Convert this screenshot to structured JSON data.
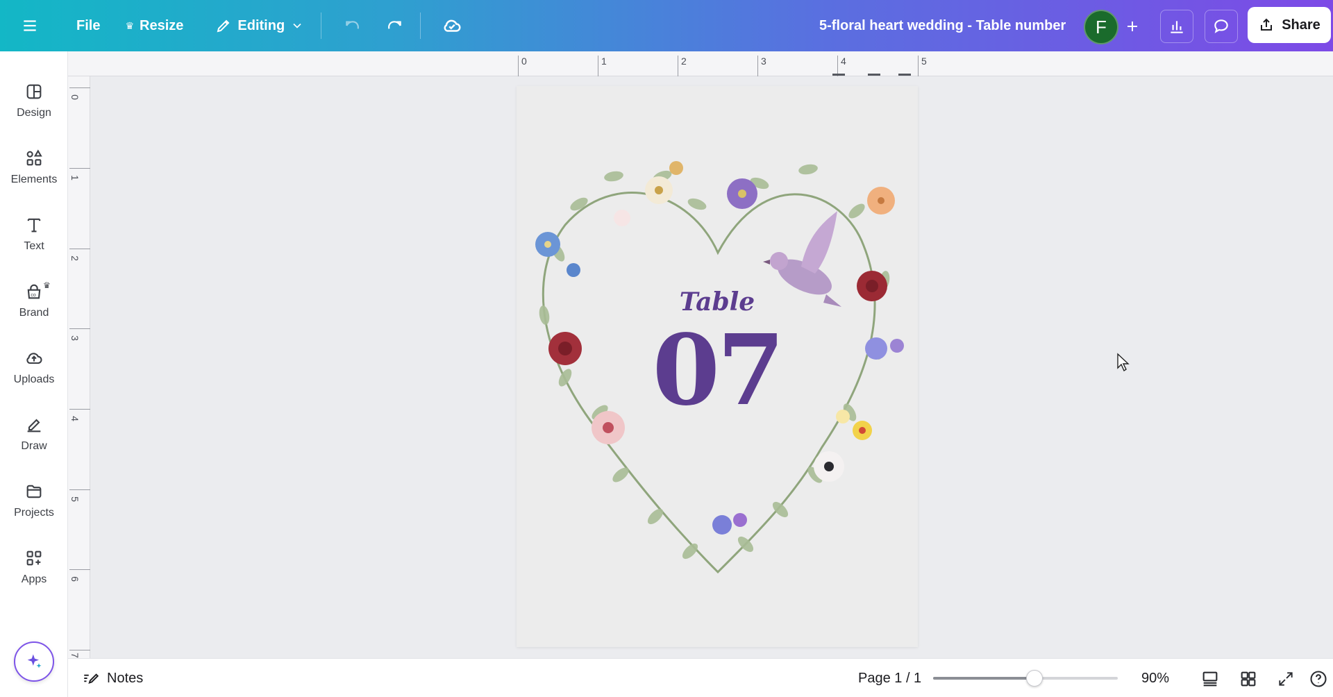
{
  "topbar": {
    "file_label": "File",
    "resize_label": "Resize",
    "mode_label": "Editing",
    "doc_title": "5-floral heart wedding - Table number",
    "avatar_initial": "F",
    "share_label": "Share"
  },
  "sidebar": {
    "items": [
      {
        "label": "Design",
        "icon": "design-icon"
      },
      {
        "label": "Elements",
        "icon": "elements-icon"
      },
      {
        "label": "Text",
        "icon": "text-icon"
      },
      {
        "label": "Brand",
        "icon": "brand-icon"
      },
      {
        "label": "Uploads",
        "icon": "uploads-icon"
      },
      {
        "label": "Draw",
        "icon": "draw-icon"
      },
      {
        "label": "Projects",
        "icon": "projects-icon"
      },
      {
        "label": "Apps",
        "icon": "apps-icon"
      }
    ]
  },
  "rulers": {
    "top_numbers": [
      "0",
      "1",
      "2",
      "3",
      "4",
      "5"
    ],
    "left_numbers": [
      "0",
      "1",
      "2",
      "3",
      "4",
      "5",
      "6",
      "7"
    ]
  },
  "design": {
    "table_label": "Table",
    "table_number": "07",
    "text_color": "#5c3d8f"
  },
  "bottombar": {
    "notes_label": "Notes",
    "page_count": "Page 1 / 1",
    "zoom_label": "90%",
    "zoom_slider_fraction": 0.55
  },
  "colors": {
    "gradient_start": "#13b7c6",
    "gradient_end": "#7d4ae6",
    "avatar": "#1a6b2c"
  }
}
